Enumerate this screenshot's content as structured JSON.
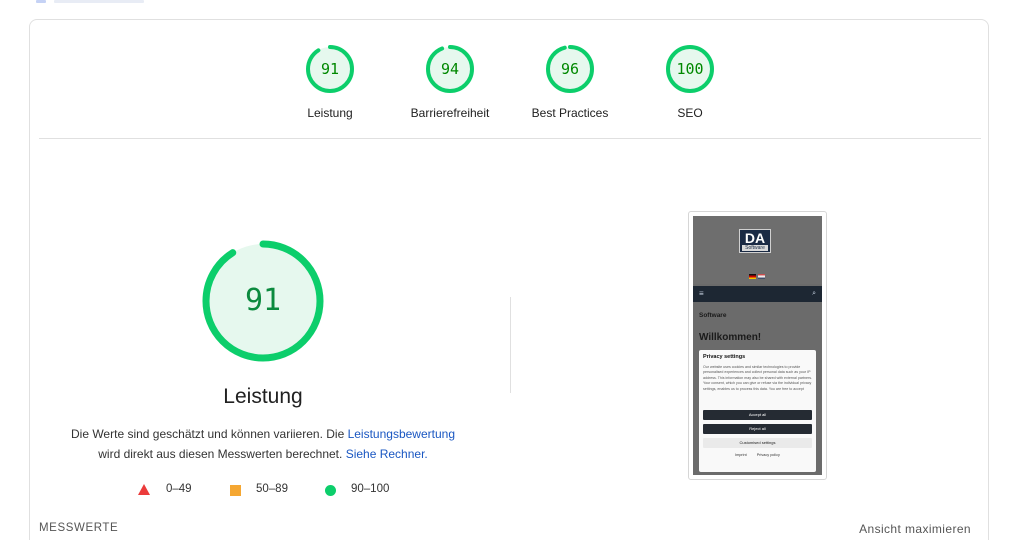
{
  "scores": [
    {
      "label": "Leistung",
      "value": "91",
      "fraction": 0.91
    },
    {
      "label": "Barrierefreiheit",
      "value": "94",
      "fraction": 0.94
    },
    {
      "label": "Best Practices",
      "value": "96",
      "fraction": 0.96
    },
    {
      "label": "SEO",
      "value": "100",
      "fraction": 1.0
    }
  ],
  "performance": {
    "score": "91",
    "fraction": 0.91,
    "title": "Leistung",
    "desc_part1": "Die Werte sind geschätzt und können variieren. Die ",
    "link1": "Leistungsbewertung",
    "desc_part2": "wird direkt aus diesen Messwerten berechnet. ",
    "link2": "Siehe Rechner."
  },
  "legend": [
    {
      "shape": "triangle",
      "range": "0–49",
      "color": "#eb3b3b"
    },
    {
      "shape": "square",
      "range": "50–89",
      "color": "#f5a732"
    },
    {
      "shape": "circle",
      "range": "90–100",
      "color": "#0cce6b"
    }
  ],
  "screenshot": {
    "logo_text": "DA",
    "logo_sub": "Software",
    "heading_small": "Software",
    "heading_big": "Willkommen!",
    "modal_title": "Privacy settings",
    "modal_body": "Our website uses cookies and similar technologies to provide personalised experiences and collect personal data such as your IP address. This information may also be shared with external partners. Your consent, which you can give or refuse via the individual privacy settings, enables us to process this data. You are free to accept",
    "accept": "Accept all",
    "reject": "Reject all",
    "customise": "Customised settings",
    "link_imprint": "Imprint",
    "link_policy": "Privacy policy"
  },
  "footer": {
    "left": "MESSWERTE",
    "right": "Ansicht maximieren"
  },
  "colors": {
    "pass": "#0cce6b",
    "pass_fill": "#e6f8ee",
    "pass_text": "#008800"
  }
}
